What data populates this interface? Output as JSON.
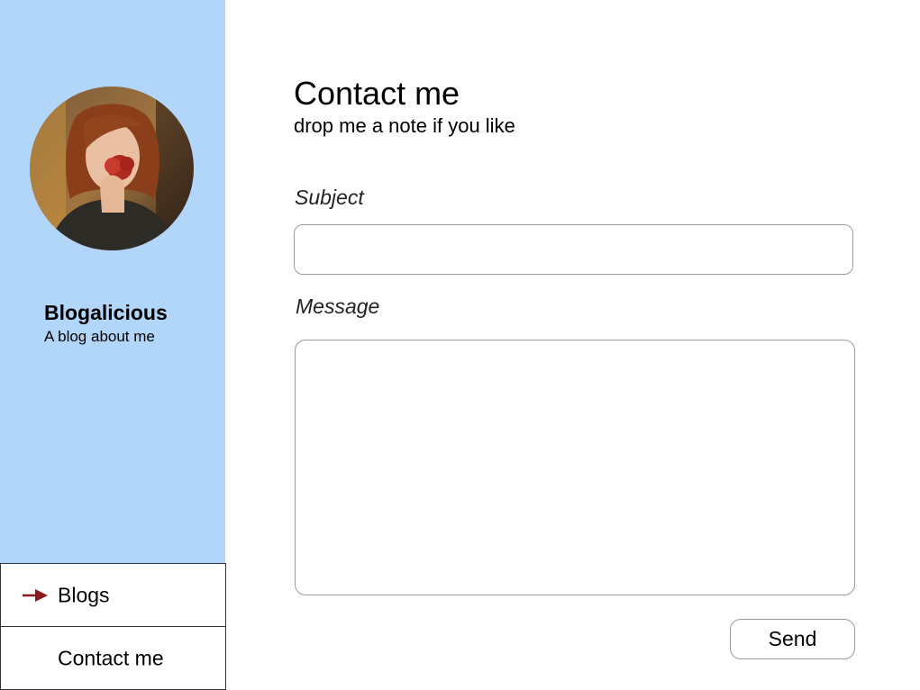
{
  "sidebar": {
    "brand_name": "Blogalicious",
    "tagline": "A blog about me",
    "avatar": "profile-photo",
    "nav": [
      {
        "label": "Blogs",
        "icon": "arrow-right-icon",
        "active": true
      },
      {
        "label": "Contact me",
        "active": false
      }
    ]
  },
  "main": {
    "title": "Contact me",
    "subtitle": "drop me a note if you like",
    "subject_label": "Subject",
    "subject_value": "",
    "message_label": "Message",
    "message_value": "",
    "send_label": "Send"
  },
  "colors": {
    "sidebar_bg": "#b1d6f9",
    "arrow": "#8b1a1a",
    "border": "#9a9a9a"
  }
}
